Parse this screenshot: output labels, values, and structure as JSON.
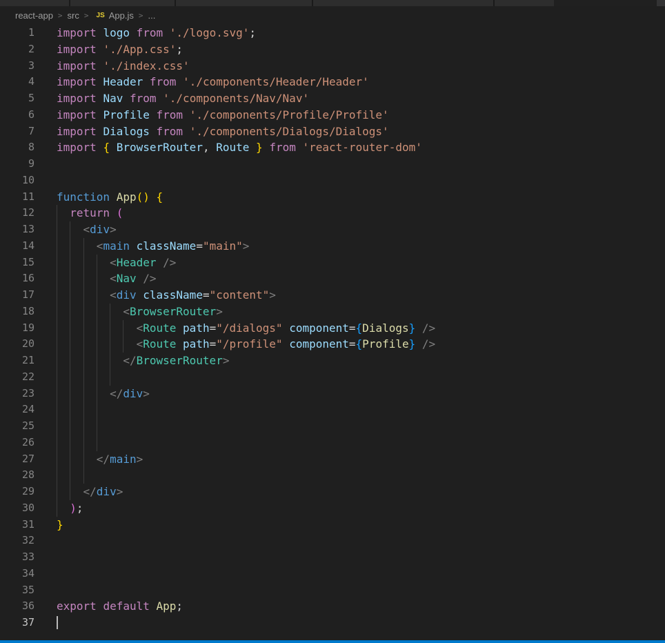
{
  "breadcrumb": {
    "items": [
      "react-app",
      "src",
      "App.js",
      "..."
    ],
    "chevron": ">",
    "file_icon_label": "JS"
  },
  "ui_colors": {
    "editor_background": "#1f1f1f",
    "tab_strip": "#2d2d2d",
    "indent_guide": "#3c3c3c",
    "line_number": "#858585",
    "active_line_number": "#c6c6c6",
    "status_bar_accent": "#007acc",
    "js_icon_yellow": "#e7cf34"
  },
  "editor": {
    "active_line": 37,
    "cursor_line": 37,
    "cursor_col": 0,
    "palette": {
      "kw": "#C586C0",
      "blue": "#569CD6",
      "var": "#9CDCFE",
      "str": "#CE9178",
      "fn": "#DCDCAA",
      "comp": "#4EC9B0",
      "tag": "#808080",
      "pun": "#D4D4D4",
      "b1": "#FFD700",
      "b2": "#DA70D6",
      "b3": "#179FFF"
    },
    "lines": [
      {
        "n": 1,
        "t": [
          [
            "import",
            "kw"
          ],
          [
            " ",
            ""
          ],
          [
            "logo",
            "var"
          ],
          [
            " ",
            ""
          ],
          [
            "from",
            "kw"
          ],
          [
            " ",
            ""
          ],
          [
            "'./logo.svg'",
            "str"
          ],
          [
            ";",
            "pun"
          ]
        ]
      },
      {
        "n": 2,
        "t": [
          [
            "import",
            "kw"
          ],
          [
            " ",
            ""
          ],
          [
            "'./App.css'",
            "str"
          ],
          [
            ";",
            "pun"
          ]
        ]
      },
      {
        "n": 3,
        "t": [
          [
            "import",
            "kw"
          ],
          [
            " ",
            ""
          ],
          [
            "'./index.css'",
            "str"
          ]
        ]
      },
      {
        "n": 4,
        "t": [
          [
            "import",
            "kw"
          ],
          [
            " ",
            ""
          ],
          [
            "Header",
            "var"
          ],
          [
            " ",
            ""
          ],
          [
            "from",
            "kw"
          ],
          [
            " ",
            ""
          ],
          [
            "'./components/Header/Header'",
            "str"
          ]
        ]
      },
      {
        "n": 5,
        "t": [
          [
            "import",
            "kw"
          ],
          [
            " ",
            ""
          ],
          [
            "Nav",
            "var"
          ],
          [
            " ",
            ""
          ],
          [
            "from",
            "kw"
          ],
          [
            " ",
            ""
          ],
          [
            "'./components/Nav/Nav'",
            "str"
          ]
        ]
      },
      {
        "n": 6,
        "t": [
          [
            "import",
            "kw"
          ],
          [
            " ",
            ""
          ],
          [
            "Profile",
            "var"
          ],
          [
            " ",
            ""
          ],
          [
            "from",
            "kw"
          ],
          [
            " ",
            ""
          ],
          [
            "'./components/Profile/Profile'",
            "str"
          ]
        ]
      },
      {
        "n": 7,
        "t": [
          [
            "import",
            "kw"
          ],
          [
            " ",
            ""
          ],
          [
            "Dialogs",
            "var"
          ],
          [
            " ",
            ""
          ],
          [
            "from",
            "kw"
          ],
          [
            " ",
            ""
          ],
          [
            "'./components/Dialogs/Dialogs'",
            "str"
          ]
        ]
      },
      {
        "n": 8,
        "t": [
          [
            "import",
            "kw"
          ],
          [
            " ",
            ""
          ],
          [
            "{",
            "b1"
          ],
          [
            " ",
            ""
          ],
          [
            "BrowserRouter",
            "var"
          ],
          [
            ",",
            "pun"
          ],
          [
            " ",
            ""
          ],
          [
            "Route",
            "var"
          ],
          [
            " ",
            ""
          ],
          [
            "}",
            "b1"
          ],
          [
            " ",
            ""
          ],
          [
            "from",
            "kw"
          ],
          [
            " ",
            ""
          ],
          [
            "'react-router-dom'",
            "str"
          ]
        ]
      },
      {
        "n": 9,
        "t": []
      },
      {
        "n": 10,
        "t": []
      },
      {
        "n": 11,
        "t": [
          [
            "function",
            "blue"
          ],
          [
            " ",
            ""
          ],
          [
            "App",
            "fn"
          ],
          [
            "(",
            "b1"
          ],
          [
            ")",
            "b1"
          ],
          [
            " ",
            ""
          ],
          [
            "{",
            "b1"
          ]
        ]
      },
      {
        "n": 12,
        "t": [
          [
            "  ",
            "ws"
          ],
          [
            "return",
            "kw"
          ],
          [
            " ",
            ""
          ],
          [
            "(",
            "b2"
          ]
        ]
      },
      {
        "n": 13,
        "t": [
          [
            "    ",
            "ws"
          ],
          [
            "<",
            "tag"
          ],
          [
            "div",
            "blue"
          ],
          [
            ">",
            "tag"
          ]
        ]
      },
      {
        "n": 14,
        "t": [
          [
            "      ",
            "ws"
          ],
          [
            "<",
            "tag"
          ],
          [
            "main",
            "blue"
          ],
          [
            " ",
            ""
          ],
          [
            "className",
            "var"
          ],
          [
            "=",
            "pun"
          ],
          [
            "\"main\"",
            "str"
          ],
          [
            ">",
            "tag"
          ]
        ]
      },
      {
        "n": 15,
        "t": [
          [
            "        ",
            "ws"
          ],
          [
            "<",
            "tag"
          ],
          [
            "Header",
            "comp"
          ],
          [
            " ",
            ""
          ],
          [
            "/>",
            "tag"
          ]
        ]
      },
      {
        "n": 16,
        "t": [
          [
            "        ",
            "ws"
          ],
          [
            "<",
            "tag"
          ],
          [
            "Nav",
            "comp"
          ],
          [
            " ",
            ""
          ],
          [
            "/>",
            "tag"
          ]
        ]
      },
      {
        "n": 17,
        "t": [
          [
            "        ",
            "ws"
          ],
          [
            "<",
            "tag"
          ],
          [
            "div",
            "blue"
          ],
          [
            " ",
            ""
          ],
          [
            "className",
            "var"
          ],
          [
            "=",
            "pun"
          ],
          [
            "\"content\"",
            "str"
          ],
          [
            ">",
            "tag"
          ]
        ]
      },
      {
        "n": 18,
        "t": [
          [
            "          ",
            "ws"
          ],
          [
            "<",
            "tag"
          ],
          [
            "BrowserRouter",
            "comp"
          ],
          [
            ">",
            "tag"
          ]
        ]
      },
      {
        "n": 19,
        "t": [
          [
            "            ",
            "ws"
          ],
          [
            "<",
            "tag"
          ],
          [
            "Route",
            "comp"
          ],
          [
            " ",
            ""
          ],
          [
            "path",
            "var"
          ],
          [
            "=",
            "pun"
          ],
          [
            "\"/dialogs\"",
            "str"
          ],
          [
            " ",
            ""
          ],
          [
            "component",
            "var"
          ],
          [
            "=",
            "pun"
          ],
          [
            "{",
            "b3"
          ],
          [
            "Dialogs",
            "fn"
          ],
          [
            "}",
            "b3"
          ],
          [
            " ",
            ""
          ],
          [
            "/>",
            "tag"
          ]
        ]
      },
      {
        "n": 20,
        "t": [
          [
            "            ",
            "ws"
          ],
          [
            "<",
            "tag"
          ],
          [
            "Route",
            "comp"
          ],
          [
            " ",
            ""
          ],
          [
            "path",
            "var"
          ],
          [
            "=",
            "pun"
          ],
          [
            "\"/profile\"",
            "str"
          ],
          [
            " ",
            ""
          ],
          [
            "component",
            "var"
          ],
          [
            "=",
            "pun"
          ],
          [
            "{",
            "b3"
          ],
          [
            "Profile",
            "fn"
          ],
          [
            "}",
            "b3"
          ],
          [
            " ",
            ""
          ],
          [
            "/>",
            "tag"
          ]
        ]
      },
      {
        "n": 21,
        "t": [
          [
            "          ",
            "ws"
          ],
          [
            "</",
            "tag"
          ],
          [
            "BrowserRouter",
            "comp"
          ],
          [
            ">",
            "tag"
          ]
        ]
      },
      {
        "n": 22,
        "t": [
          [
            "          ",
            "ws"
          ]
        ]
      },
      {
        "n": 23,
        "t": [
          [
            "        ",
            "ws"
          ],
          [
            "</",
            "tag"
          ],
          [
            "div",
            "blue"
          ],
          [
            ">",
            "tag"
          ]
        ]
      },
      {
        "n": 24,
        "t": [
          [
            "        ",
            "ws"
          ]
        ]
      },
      {
        "n": 25,
        "t": [
          [
            "        ",
            "ws"
          ]
        ]
      },
      {
        "n": 26,
        "t": [
          [
            "        ",
            "ws"
          ]
        ]
      },
      {
        "n": 27,
        "t": [
          [
            "      ",
            "ws"
          ],
          [
            "</",
            "tag"
          ],
          [
            "main",
            "blue"
          ],
          [
            ">",
            "tag"
          ]
        ]
      },
      {
        "n": 28,
        "t": [
          [
            "      ",
            "ws"
          ]
        ]
      },
      {
        "n": 29,
        "t": [
          [
            "    ",
            "ws"
          ],
          [
            "</",
            "tag"
          ],
          [
            "div",
            "blue"
          ],
          [
            ">",
            "tag"
          ]
        ]
      },
      {
        "n": 30,
        "t": [
          [
            "  ",
            "ws"
          ],
          [
            ")",
            "b2"
          ],
          [
            ";",
            "pun"
          ]
        ]
      },
      {
        "n": 31,
        "t": [
          [
            "}",
            "b1"
          ]
        ]
      },
      {
        "n": 32,
        "t": []
      },
      {
        "n": 33,
        "t": []
      },
      {
        "n": 34,
        "t": []
      },
      {
        "n": 35,
        "t": []
      },
      {
        "n": 36,
        "t": [
          [
            "export",
            "kw"
          ],
          [
            " ",
            ""
          ],
          [
            "default",
            "kw"
          ],
          [
            " ",
            ""
          ],
          [
            "App",
            "fn"
          ],
          [
            ";",
            "pun"
          ]
        ]
      },
      {
        "n": 37,
        "t": []
      }
    ]
  }
}
